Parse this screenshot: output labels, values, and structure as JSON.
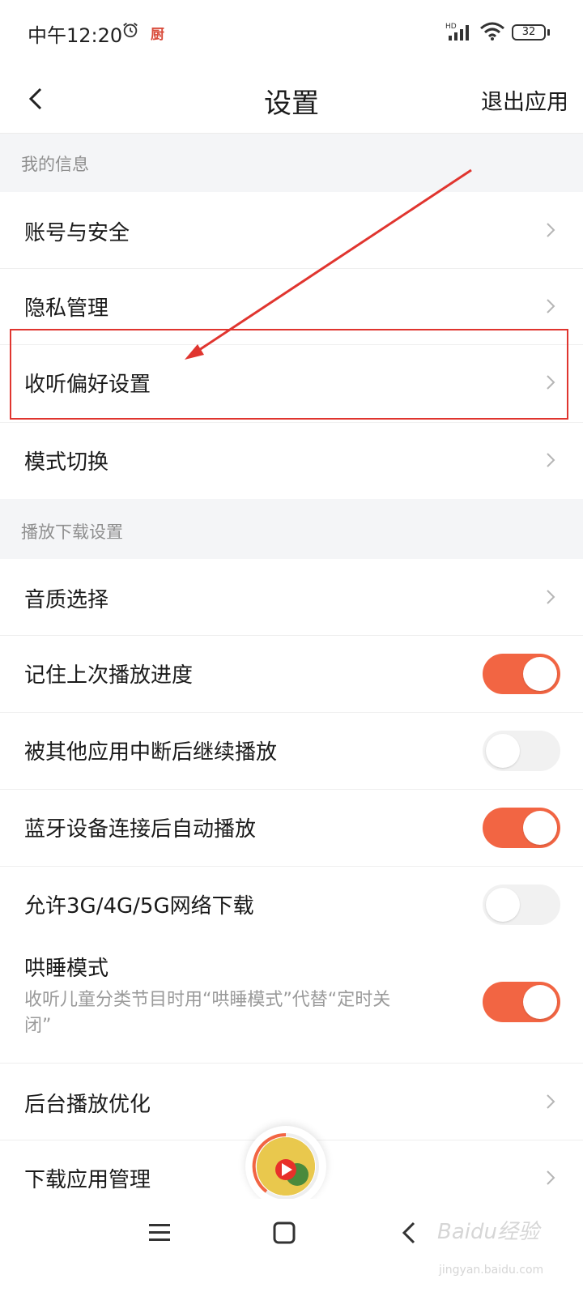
{
  "status_bar": {
    "time": "中午12:20",
    "app_badge": "厨",
    "signal_label": "HD",
    "battery": "32",
    "icons": [
      "alarm-icon",
      "signal-icon",
      "wifi-icon",
      "battery-icon"
    ]
  },
  "header": {
    "back_icon": "chevron-left-icon",
    "title": "设置",
    "exit_label": "退出应用"
  },
  "sections": {
    "my_info": "我的信息",
    "playback": "播放下载设置"
  },
  "rows": {
    "account": "账号与安全",
    "privacy": "隐私管理",
    "listen_pref": "收听偏好设置",
    "mode_switch": "模式切换",
    "audio_quality": "音质选择",
    "remember_progress": "记住上次播放进度",
    "resume_after_interrupt": "被其他应用中断后继续播放",
    "bluetooth_autoplay": "蓝牙设备连接后自动播放",
    "allow_mobile_download": "允许3G/4G/5G网络下载",
    "sleep_mode": "哄睡模式",
    "sleep_mode_desc": "收听儿童分类节目时用“哄睡模式”代替“定时关闭”",
    "background_opt": "后台播放优化",
    "download_manage": "下载应用管理"
  },
  "toggles": {
    "remember_progress": true,
    "resume_after_interrupt": false,
    "bluetooth_autoplay": true,
    "allow_mobile_download": false,
    "sleep_mode": true
  },
  "colors": {
    "accent": "#f26543",
    "annotation": "#e0352f",
    "section_bg": "#f4f5f7"
  },
  "watermark": {
    "brand": "Baidu经验",
    "url": "jingyan.baidu.com"
  }
}
